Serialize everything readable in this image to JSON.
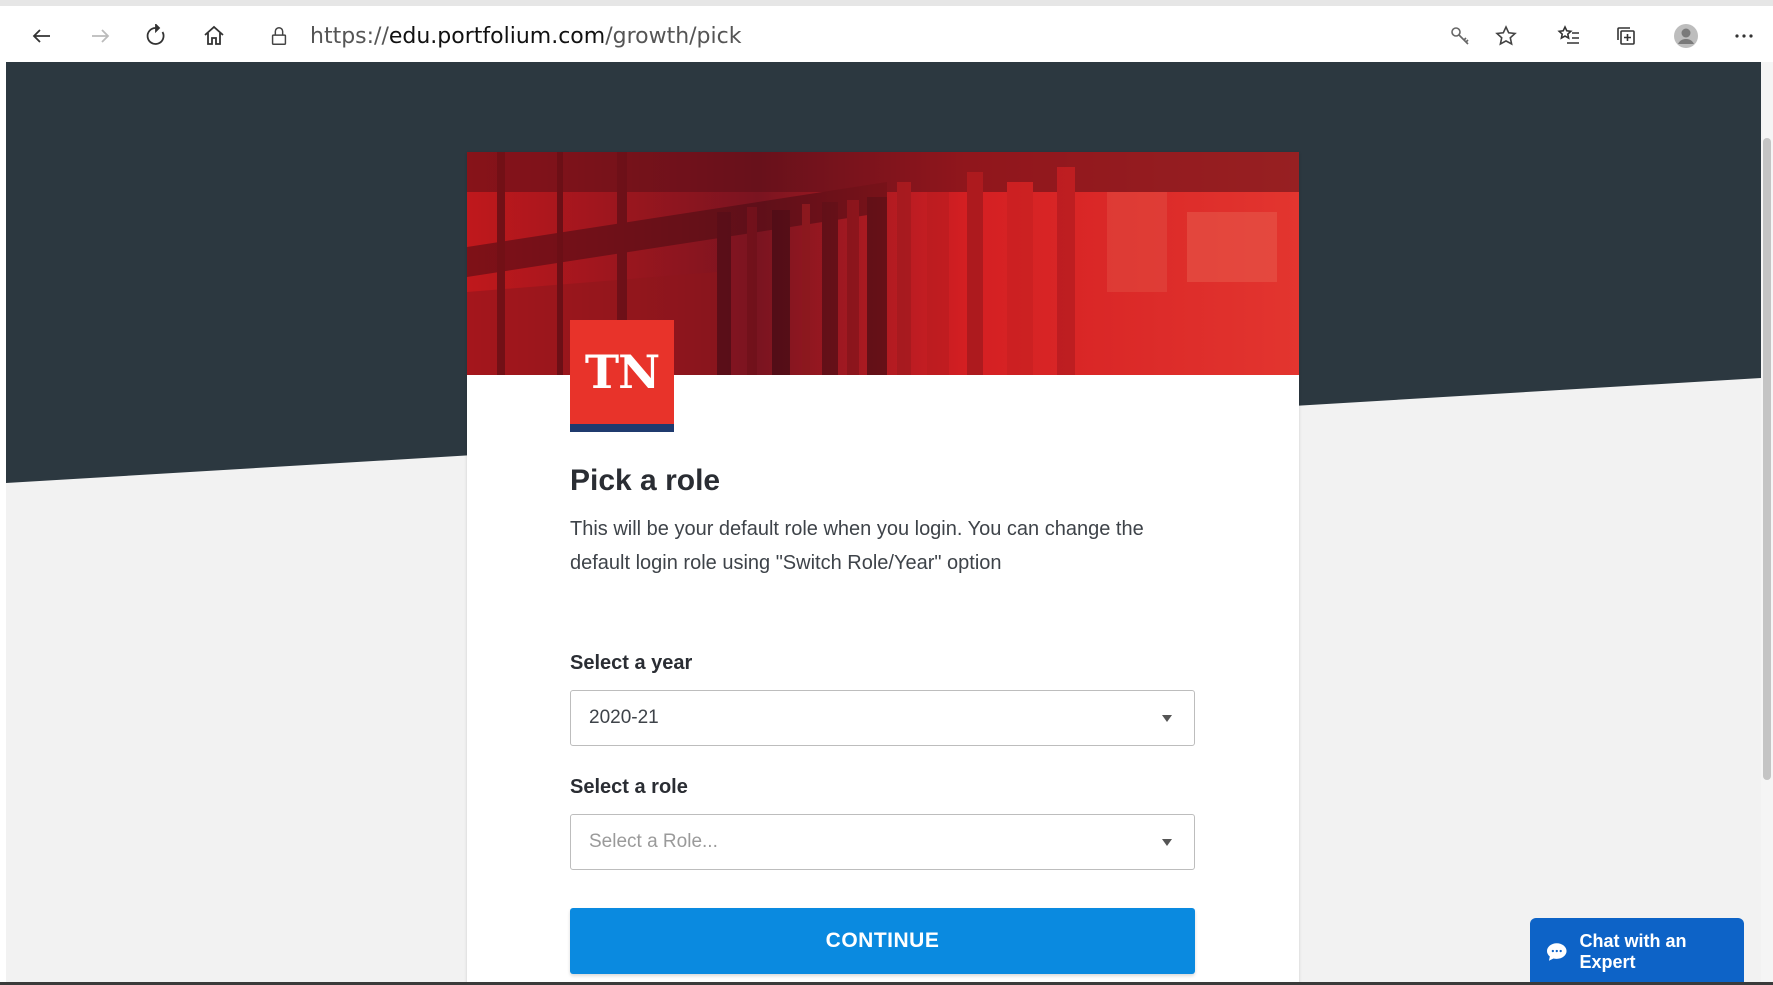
{
  "browser": {
    "url_prefix": "https://",
    "url_domain": "edu.portfolium.com",
    "url_path": "/growth/pick",
    "toolbar_icons": [
      "back-icon",
      "forward-icon",
      "refresh-icon",
      "home-icon",
      "lock-icon",
      "key-icon",
      "star-icon",
      "favorites-icon",
      "collections-icon",
      "profile-icon",
      "more-icon"
    ]
  },
  "logo": {
    "text": "TN",
    "red": "#e8332a",
    "blue": "#1f3a6e"
  },
  "form": {
    "title": "Pick a role",
    "description": "This will be your default role when you login. You can change the default login role using \"Switch Role/Year\" option",
    "year_label": "Select a year",
    "year_value": "2020-21",
    "role_label": "Select a role",
    "role_placeholder": "Select a Role...",
    "continue_label": "CONTINUE"
  },
  "chat": {
    "label": "Chat with an Expert"
  },
  "colors": {
    "dark_bg": "#2c3840",
    "accent": "#0a8ae0",
    "chat": "#0d63c7"
  }
}
